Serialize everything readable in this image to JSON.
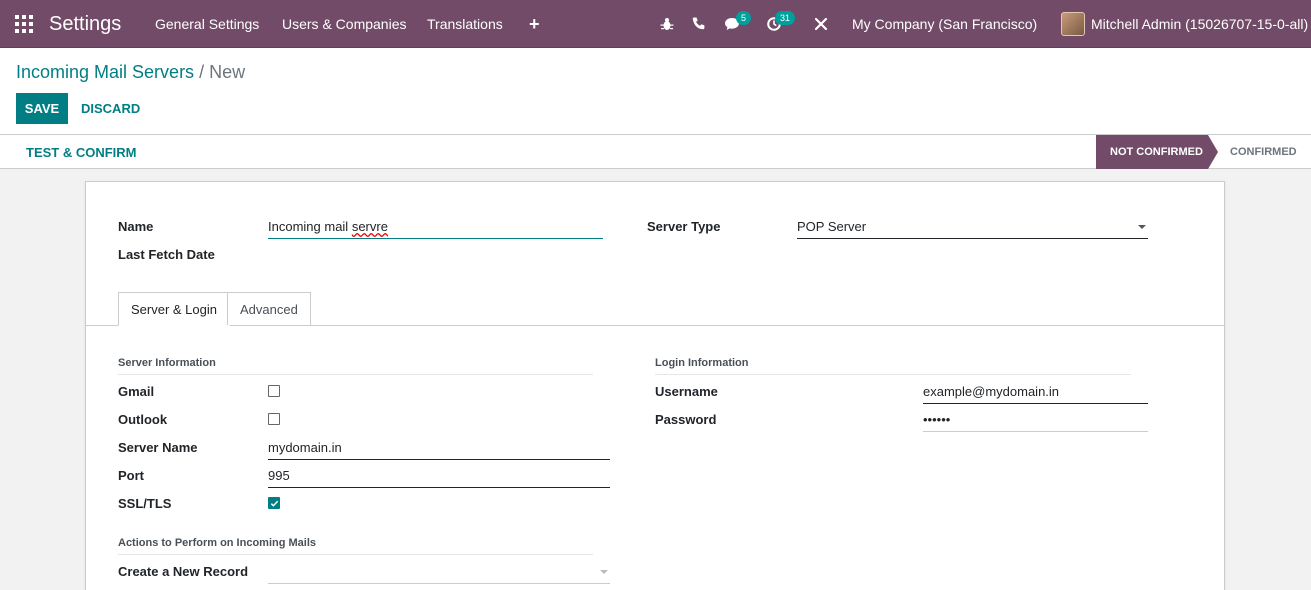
{
  "navbar": {
    "brand": "Settings",
    "menu": [
      "General Settings",
      "Users & Companies",
      "Translations"
    ],
    "plus": "+",
    "messages_badge": "5",
    "activities_badge": "31",
    "company": "My Company (San Francisco)",
    "user": "Mitchell Admin (15026707-15-0-all)"
  },
  "breadcrumb": {
    "parent": "Incoming Mail Servers",
    "separator": " / ",
    "current": "New"
  },
  "actions": {
    "save": "SAVE",
    "discard": "DISCARD",
    "test_confirm": "TEST & CONFIRM"
  },
  "statusbar": {
    "active": "NOT CONFIRMED",
    "next": "CONFIRMED"
  },
  "form": {
    "name_label": "Name",
    "name_value_a": "Incoming mail ",
    "name_value_b": "servre",
    "last_fetch_label": "Last Fetch Date",
    "server_type_label": "Server Type",
    "server_type_value": "POP Server",
    "tabs": [
      "Server & Login",
      "Advanced"
    ],
    "server_info_title": "Server Information",
    "gmail_label": "Gmail",
    "gmail_checked": false,
    "outlook_label": "Outlook",
    "outlook_checked": false,
    "server_name_label": "Server Name",
    "server_name_value": "mydomain.in",
    "port_label": "Port",
    "port_value": "995",
    "ssl_label": "SSL/TLS",
    "ssl_checked": true,
    "login_info_title": "Login Information",
    "username_label": "Username",
    "username_value": "example@mydomain.in",
    "password_label": "Password",
    "password_value": "••••••",
    "actions_title": "Actions to Perform on Incoming Mails",
    "create_record_label": "Create a New Record",
    "create_record_value": ""
  },
  "colors": {
    "brand": "#714b67",
    "accent": "#017e84",
    "badge": "#00a09d"
  }
}
